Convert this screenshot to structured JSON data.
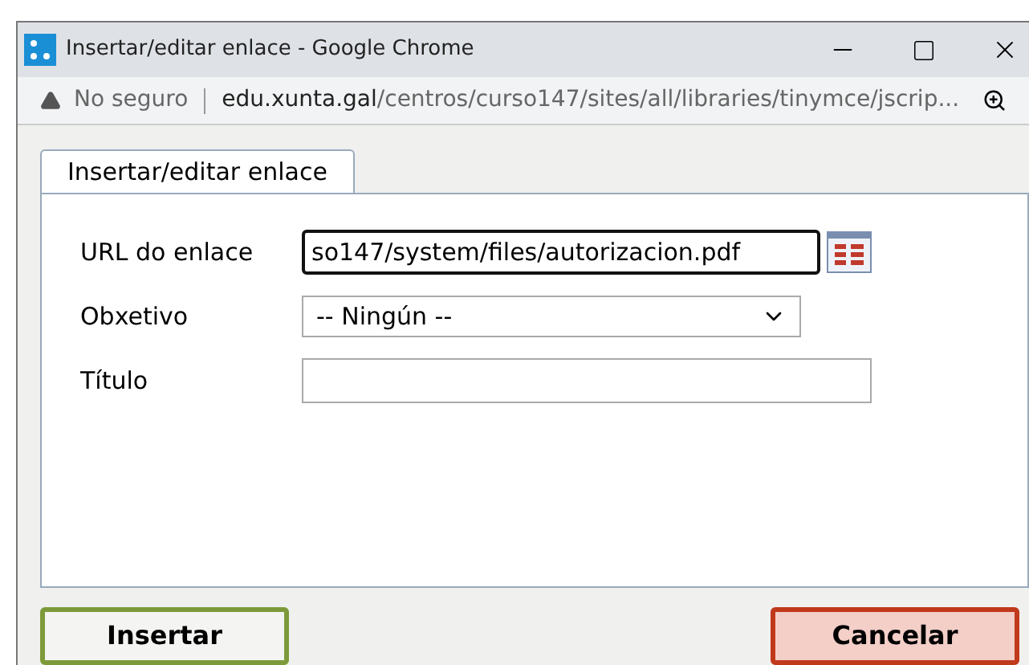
{
  "window": {
    "title": "Insertar/editar enlace - Google Chrome"
  },
  "address_bar": {
    "security": "No seguro",
    "domain": "edu.xunta.gal",
    "path": "/centros/curso147/sites/all/libraries/tinymce/jscrip..."
  },
  "tabs": [
    {
      "label": "Insertar/editar enlace",
      "selected": true
    }
  ],
  "fields": [
    {
      "kind": "text",
      "label": "URL do enlace",
      "value": "so147/system/files/autorizacion.pdf",
      "focused": true,
      "browse": true
    },
    {
      "kind": "select",
      "label": "Obxetivo",
      "value": "-- Ningún --"
    },
    {
      "kind": "text",
      "label": "Título",
      "focused": false
    }
  ],
  "buttons": [
    {
      "label": "Insertar",
      "kind": "confirm"
    },
    {
      "label": "Cancelar",
      "kind": "cancel"
    }
  ]
}
